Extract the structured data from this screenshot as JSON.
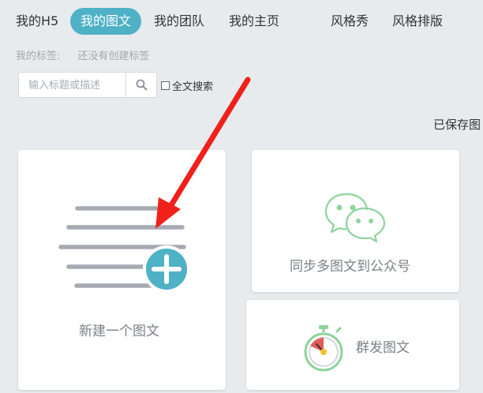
{
  "nav": {
    "items": [
      {
        "label": "我的H5"
      },
      {
        "label": "我的图文",
        "active": true
      },
      {
        "label": "我的团队"
      },
      {
        "label": "我的主页"
      },
      {
        "label": "风格秀"
      },
      {
        "label": "风格排版"
      }
    ]
  },
  "tags": {
    "label": "我的标签:",
    "empty": "还没有创建标签"
  },
  "search": {
    "placeholder": "输入标题或描述",
    "value": "",
    "fulltext_label": "全文搜索",
    "fulltext_checked": false
  },
  "saved_text": "已保存图",
  "cards": {
    "new": {
      "label": "新建一个图文",
      "icon": "document-add-icon"
    },
    "sync": {
      "label": "同步多图文到公众号",
      "icon": "wechat-icon"
    },
    "mass": {
      "label": "群发图文",
      "icon": "stopwatch-icon"
    }
  },
  "colors": {
    "accent": "#4fb1c6",
    "background": "#e8ebee",
    "arrow": "#f0211b",
    "wechat_green": "#8fd39c"
  }
}
